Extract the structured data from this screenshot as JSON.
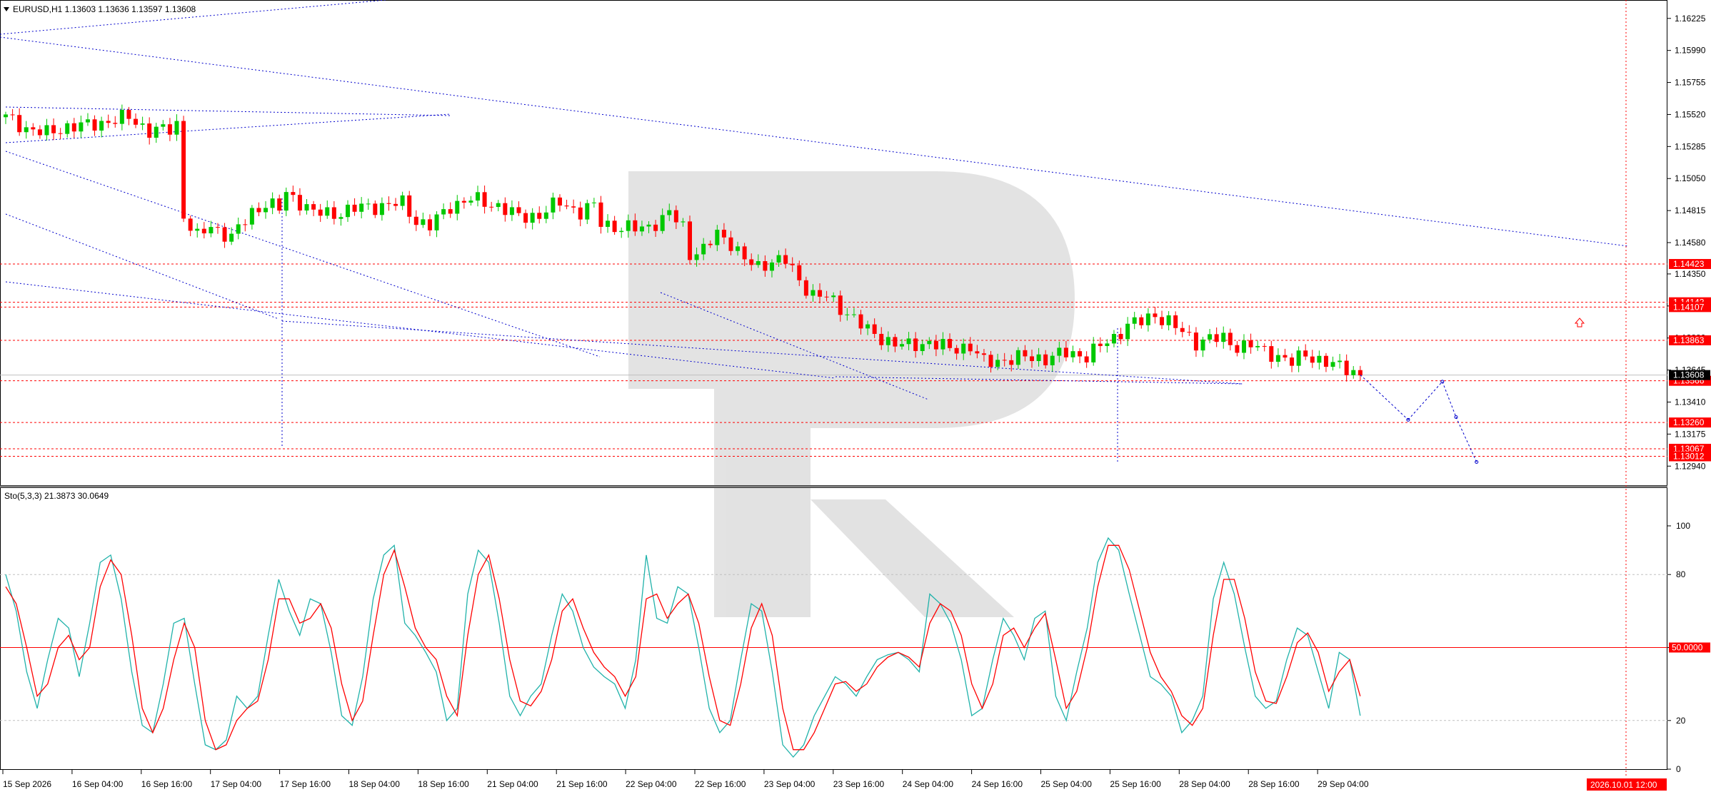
{
  "header": {
    "symbol_line": "EURUSD,H1  1.13603 1.13636 1.13597 1.13608"
  },
  "chart_data": [
    {
      "type": "candlestick",
      "title": "EURUSD,H1  1.13603 1.13636 1.13597 1.13608",
      "ylim": [
        1.128,
        1.1636
      ],
      "y_ticks": [
        "1.16225",
        "1.15990",
        "1.15755",
        "1.15520",
        "1.15285",
        "1.15050",
        "1.14815",
        "1.14580",
        "1.14350",
        "1.14115",
        "1.13880",
        "1.13645",
        "1.13410",
        "1.13175",
        "1.12940"
      ],
      "x_ticks": [
        "15 Sep 2026",
        "16 Sep 04:00",
        "16 Sep 16:00",
        "17 Sep 04:00",
        "17 Sep 16:00",
        "18 Sep 04:00",
        "18 Sep 16:00",
        "21 Sep 04:00",
        "21 Sep 16:00",
        "22 Sep 04:00",
        "22 Sep 16:00",
        "23 Sep 04:00",
        "23 Sep 16:00",
        "24 Sep 04:00",
        "24 Sep 16:00",
        "25 Sep 04:00",
        "25 Sep 16:00",
        "28 Sep 04:00",
        "28 Sep 16:00",
        "29 Sep 04:00"
      ],
      "current_price_label": "1.13608",
      "current_price": 1.13608,
      "level_labels": [
        "1.14423",
        "1.14142",
        "1.14107",
        "1.13863",
        "1.13566",
        "1.13260",
        "1.13067",
        "1.13012"
      ],
      "levels": [
        1.14423,
        1.14142,
        1.14107,
        1.13863,
        1.13566,
        1.1326,
        1.13067,
        1.13012
      ],
      "bull_color": "#00c800",
      "bear_color": "#ff0000",
      "level_color": "#ff0000",
      "trend_color": "#0000cc",
      "close_path": [
        [
          0,
          1.155
        ],
        [
          3,
          1.1542
        ],
        [
          6,
          1.1538
        ],
        [
          9,
          1.1543
        ],
        [
          12,
          1.1544
        ],
        [
          15,
          1.1547
        ],
        [
          18,
          1.155
        ],
        [
          21,
          1.154
        ],
        [
          24,
          1.1541
        ],
        [
          25,
          1.1545
        ],
        [
          26,
          1.1478
        ],
        [
          28,
          1.1462
        ],
        [
          30,
          1.147
        ],
        [
          33,
          1.1462
        ],
        [
          36,
          1.148
        ],
        [
          38,
          1.1487
        ],
        [
          40,
          1.1483
        ],
        [
          41,
          1.1494
        ],
        [
          43,
          1.1488
        ],
        [
          45,
          1.148
        ],
        [
          48,
          1.1479
        ],
        [
          52,
          1.1484
        ],
        [
          55,
          1.1485
        ],
        [
          58,
          1.1487
        ],
        [
          60,
          1.1474
        ],
        [
          62,
          1.147
        ],
        [
          65,
          1.1485
        ],
        [
          68,
          1.149
        ],
        [
          72,
          1.1485
        ],
        [
          75,
          1.1477
        ],
        [
          78,
          1.1478
        ],
        [
          81,
          1.1488
        ],
        [
          84,
          1.148
        ],
        [
          86,
          1.1485
        ],
        [
          87,
          1.1473
        ],
        [
          90,
          1.1468
        ],
        [
          93,
          1.1469
        ],
        [
          96,
          1.1474
        ],
        [
          97,
          1.148
        ],
        [
          99,
          1.147
        ],
        [
          100,
          1.145
        ],
        [
          102,
          1.1452
        ],
        [
          104,
          1.1465
        ],
        [
          106,
          1.1458
        ],
        [
          108,
          1.1445
        ],
        [
          110,
          1.144
        ],
        [
          112,
          1.1445
        ],
        [
          114,
          1.1445
        ],
        [
          116,
          1.143
        ],
        [
          118,
          1.142
        ],
        [
          120,
          1.1418
        ],
        [
          122,
          1.141
        ],
        [
          124,
          1.1403
        ],
        [
          126,
          1.1393
        ],
        [
          128,
          1.1388
        ],
        [
          130,
          1.1384
        ],
        [
          132,
          1.1382
        ],
        [
          135,
          1.1385
        ],
        [
          138,
          1.138
        ],
        [
          141,
          1.1382
        ],
        [
          143,
          1.137
        ],
        [
          146,
          1.1372
        ],
        [
          149,
          1.1374
        ],
        [
          152,
          1.1373
        ],
        [
          155,
          1.1377
        ],
        [
          158,
          1.1375
        ],
        [
          160,
          1.1382
        ],
        [
          162,
          1.1388
        ],
        [
          164,
          1.1398
        ],
        [
          166,
          1.14
        ],
        [
          168,
          1.1405
        ],
        [
          170,
          1.14
        ],
        [
          172,
          1.1392
        ],
        [
          174,
          1.1385
        ],
        [
          176,
          1.1388
        ],
        [
          178,
          1.1387
        ],
        [
          180,
          1.1382
        ],
        [
          182,
          1.1383
        ],
        [
          184,
          1.1378
        ],
        [
          186,
          1.1375
        ],
        [
          188,
          1.137
        ],
        [
          190,
          1.1376
        ],
        [
          192,
          1.1372
        ],
        [
          194,
          1.1368
        ],
        [
          196,
          1.1366
        ],
        [
          198,
          1.1361
        ]
      ],
      "forecast_path": [
        [
          198,
          1.1361
        ],
        [
          205,
          1.1328
        ],
        [
          210,
          1.1356
        ],
        [
          212,
          1.133
        ],
        [
          215,
          1.1297
        ]
      ]
    },
    {
      "type": "line",
      "title": "Sto(5,3,3) 21.3873 30.0649",
      "ylim": [
        0,
        100
      ],
      "y_ticks": [
        "100",
        "80",
        "50.0000",
        "20",
        "0"
      ],
      "levels": [
        80,
        50,
        20
      ],
      "series": [
        {
          "color": "#20b2aa",
          "values": [
            80,
            65,
            40,
            25,
            45,
            62,
            58,
            38,
            60,
            85,
            88,
            70,
            40,
            18,
            15,
            35,
            60,
            62,
            35,
            10,
            8,
            12,
            30,
            25,
            30,
            55,
            78,
            65,
            55,
            70,
            68,
            48,
            22,
            18,
            38,
            70,
            88,
            92,
            60,
            55,
            48,
            40,
            20,
            25,
            72,
            90,
            85,
            60,
            30,
            22,
            30,
            35,
            55,
            72,
            65,
            50,
            42,
            38,
            35,
            25,
            45,
            88,
            62,
            60,
            75,
            72,
            50,
            25,
            15,
            20,
            45,
            68,
            65,
            40,
            10,
            5,
            10,
            22,
            30,
            38,
            35,
            30,
            38,
            45,
            47,
            48,
            45,
            40,
            72,
            68,
            60,
            45,
            22,
            25,
            45,
            62,
            55,
            45,
            62,
            65,
            30,
            20,
            40,
            58,
            85,
            95,
            90,
            72,
            55,
            38,
            35,
            30,
            15,
            20,
            30,
            70,
            85,
            72,
            50,
            30,
            25,
            28,
            45,
            58,
            55,
            40,
            25,
            48,
            45,
            22
          ]
        },
        {
          "color": "#ff0000",
          "values": [
            75,
            68,
            50,
            30,
            35,
            50,
            55,
            45,
            50,
            75,
            86,
            80,
            55,
            25,
            15,
            25,
            45,
            60,
            50,
            20,
            8,
            10,
            20,
            25,
            28,
            45,
            70,
            70,
            60,
            62,
            68,
            58,
            35,
            20,
            28,
            55,
            80,
            90,
            75,
            58,
            50,
            45,
            30,
            22,
            55,
            80,
            88,
            70,
            45,
            28,
            26,
            32,
            45,
            65,
            70,
            58,
            48,
            42,
            38,
            30,
            38,
            70,
            72,
            62,
            68,
            72,
            60,
            38,
            20,
            18,
            35,
            58,
            68,
            55,
            25,
            8,
            8,
            15,
            25,
            35,
            36,
            32,
            35,
            42,
            46,
            48,
            46,
            42,
            60,
            68,
            65,
            55,
            35,
            25,
            35,
            55,
            58,
            50,
            58,
            64,
            45,
            25,
            32,
            50,
            75,
            92,
            92,
            82,
            65,
            48,
            38,
            32,
            22,
            18,
            25,
            55,
            78,
            78,
            62,
            40,
            28,
            27,
            38,
            52,
            56,
            48,
            32,
            40,
            45,
            30
          ]
        }
      ]
    }
  ],
  "footer": {
    "cursor_time_label": "2026.10.01 12:00"
  }
}
